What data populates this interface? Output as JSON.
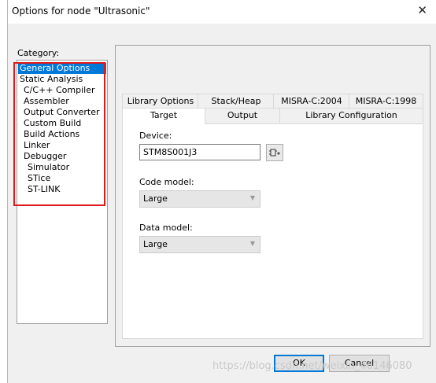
{
  "dialog": {
    "title": "Options for node \"Ultrasonic\"",
    "close_icon": "close-icon"
  },
  "category": {
    "label": "Category:",
    "items": [
      {
        "label": "General Options",
        "selected": true
      },
      {
        "label": "Static Analysis"
      },
      {
        "label": "C/C++ Compiler"
      },
      {
        "label": "Assembler"
      },
      {
        "label": "Output Converter"
      },
      {
        "label": "Custom Build"
      },
      {
        "label": "Build Actions"
      },
      {
        "label": "Linker"
      },
      {
        "label": "Debugger"
      },
      {
        "label": "Simulator"
      },
      {
        "label": "STice"
      },
      {
        "label": "ST-LINK"
      }
    ]
  },
  "tabs": {
    "row1": [
      "Library Options",
      "Stack/Heap",
      "MISRA-C:2004",
      "MISRA-C:1998"
    ],
    "row2": [
      "Target",
      "Output",
      "Library Configuration"
    ],
    "active": "Target"
  },
  "target": {
    "device_label": "Device:",
    "device_value": "STM8S001J3",
    "code_model_label": "Code model:",
    "code_model_value": "Large",
    "data_model_label": "Data model:",
    "data_model_value": "Large"
  },
  "buttons": {
    "ok": "OK",
    "cancel": "Cancel"
  },
  "watermark": "https://blog.csdn.net/weixin_46146080",
  "colors": {
    "selection": "#0078d7",
    "highlight_border": "#e0191b"
  }
}
